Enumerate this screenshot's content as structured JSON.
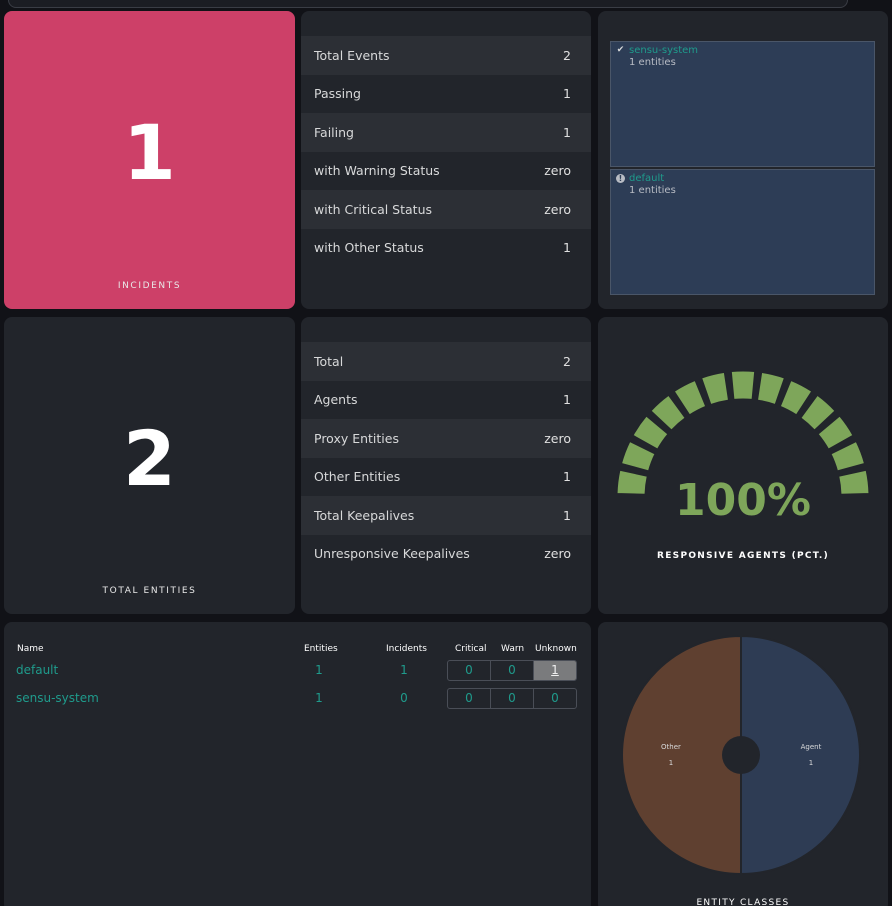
{
  "incidents": {
    "value": "1",
    "label": "INCIDENTS"
  },
  "events": {
    "rows": [
      {
        "label": "Total Events",
        "value": "2"
      },
      {
        "label": "Passing",
        "value": "1"
      },
      {
        "label": "Failing",
        "value": "1"
      },
      {
        "label": "with Warning Status",
        "value": "zero"
      },
      {
        "label": "with Critical Status",
        "value": "zero"
      },
      {
        "label": "with Other Status",
        "value": "1"
      }
    ]
  },
  "namespaces_status": {
    "items": [
      {
        "name": "sensu-system",
        "entities": "1 entities",
        "status_icon": "check-icon"
      },
      {
        "name": "default",
        "entities": "1 entities",
        "status_icon": "info-icon"
      }
    ]
  },
  "total_entities": {
    "value": "2",
    "label": "TOTAL ENTITIES"
  },
  "entities": {
    "rows": [
      {
        "label": "Total",
        "value": "2"
      },
      {
        "label": "Agents",
        "value": "1"
      },
      {
        "label": "Proxy Entities",
        "value": "zero"
      },
      {
        "label": "Other Entities",
        "value": "1"
      },
      {
        "label": "Total Keepalives",
        "value": "1"
      },
      {
        "label": "Unresponsive Keepalives",
        "value": "zero"
      }
    ]
  },
  "gauge": {
    "value": "100%",
    "fraction": 1.0,
    "label": "RESPONSIVE AGENTS (PCT.)",
    "color": "#7ea65a"
  },
  "ns_table": {
    "headers": {
      "name": "Name",
      "entities": "Entities",
      "incidents": "Incidents",
      "critical": "Critical",
      "warn": "Warn",
      "unknown": "Unknown"
    },
    "rows": [
      {
        "name": "default",
        "entities": "1",
        "incidents": "1",
        "critical": "0",
        "warn": "0",
        "unknown": "1"
      },
      {
        "name": "sensu-system",
        "entities": "1",
        "incidents": "0",
        "critical": "0",
        "warn": "0",
        "unknown": "0"
      }
    ]
  },
  "entity_classes": {
    "label": "ENTITY CLASSES",
    "chart_data": {
      "type": "pie",
      "slices": [
        {
          "name": "Agent",
          "value": 1,
          "color": "#2e3c54"
        },
        {
          "name": "Other",
          "value": 1,
          "color": "#5f4030"
        }
      ]
    }
  },
  "colors": {
    "accent": "#1f9b8c",
    "incident": "#cd4068",
    "panel": "#22252b",
    "background": "#111217"
  }
}
